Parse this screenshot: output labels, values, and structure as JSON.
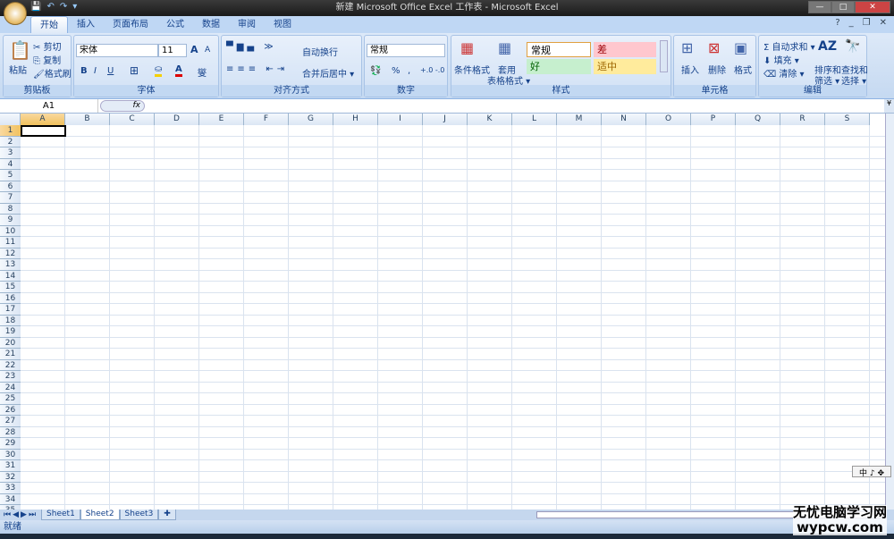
{
  "window": {
    "title": "新建 Microsoft Office Excel 工作表 - Microsoft Excel",
    "controls": [
      "—",
      "□",
      "✕"
    ]
  },
  "qat": [
    "💾",
    "↶",
    "↷",
    "▾"
  ],
  "tabs": [
    "开始",
    "插入",
    "页面布局",
    "公式",
    "数据",
    "审阅",
    "视图"
  ],
  "active_tab": 0,
  "ribbon": {
    "clipboard": {
      "label": "剪贴板",
      "paste": "粘贴",
      "cut": "剪切",
      "copy": "复制",
      "painter": "格式刷"
    },
    "font": {
      "label": "字体",
      "name": "宋体",
      "size": "11",
      "bold": "B",
      "italic": "I",
      "underline": "U",
      "grow": "A",
      "shrink": "A",
      "color_letter": "A",
      "phonetic": "燮"
    },
    "alignment": {
      "label": "对齐方式",
      "wrap": "自动换行",
      "merge": "合并后居中 ▾"
    },
    "number": {
      "label": "数字",
      "format": "常规",
      "percent": "%",
      "comma": ","
    },
    "styles": {
      "label": "样式",
      "conditional": "条件格式",
      "table": "套用",
      "table2": "表格格式 ▾",
      "normal": "常规",
      "bad": "差",
      "good": "好",
      "neutral": "适中"
    },
    "cells": {
      "label": "单元格",
      "insert": "插入",
      "delete": "删除",
      "format": "格式"
    },
    "editing": {
      "label": "编辑",
      "autosum": "Σ 自动求和 ▾",
      "fill": "填充 ▾",
      "clear": "清除 ▾",
      "sort": "排序和",
      "sort2": "筛选 ▾",
      "find": "查找和",
      "find2": "选择 ▾"
    }
  },
  "formula_bar": {
    "name_box": "A1",
    "fx": "fx",
    "value": ""
  },
  "columns": [
    "A",
    "B",
    "C",
    "D",
    "E",
    "F",
    "G",
    "H",
    "I",
    "J",
    "K",
    "L",
    "M",
    "N",
    "O",
    "P",
    "Q",
    "R",
    "S"
  ],
  "row_count": 34,
  "active_cell": "A1",
  "sheets": [
    "Sheet1",
    "Sheet2",
    "Sheet3"
  ],
  "active_sheet": 1,
  "status": "就绪",
  "ime": "中 ♪ ✥",
  "watermark": [
    "无忧电脑学习网",
    "wypcw.com"
  ]
}
